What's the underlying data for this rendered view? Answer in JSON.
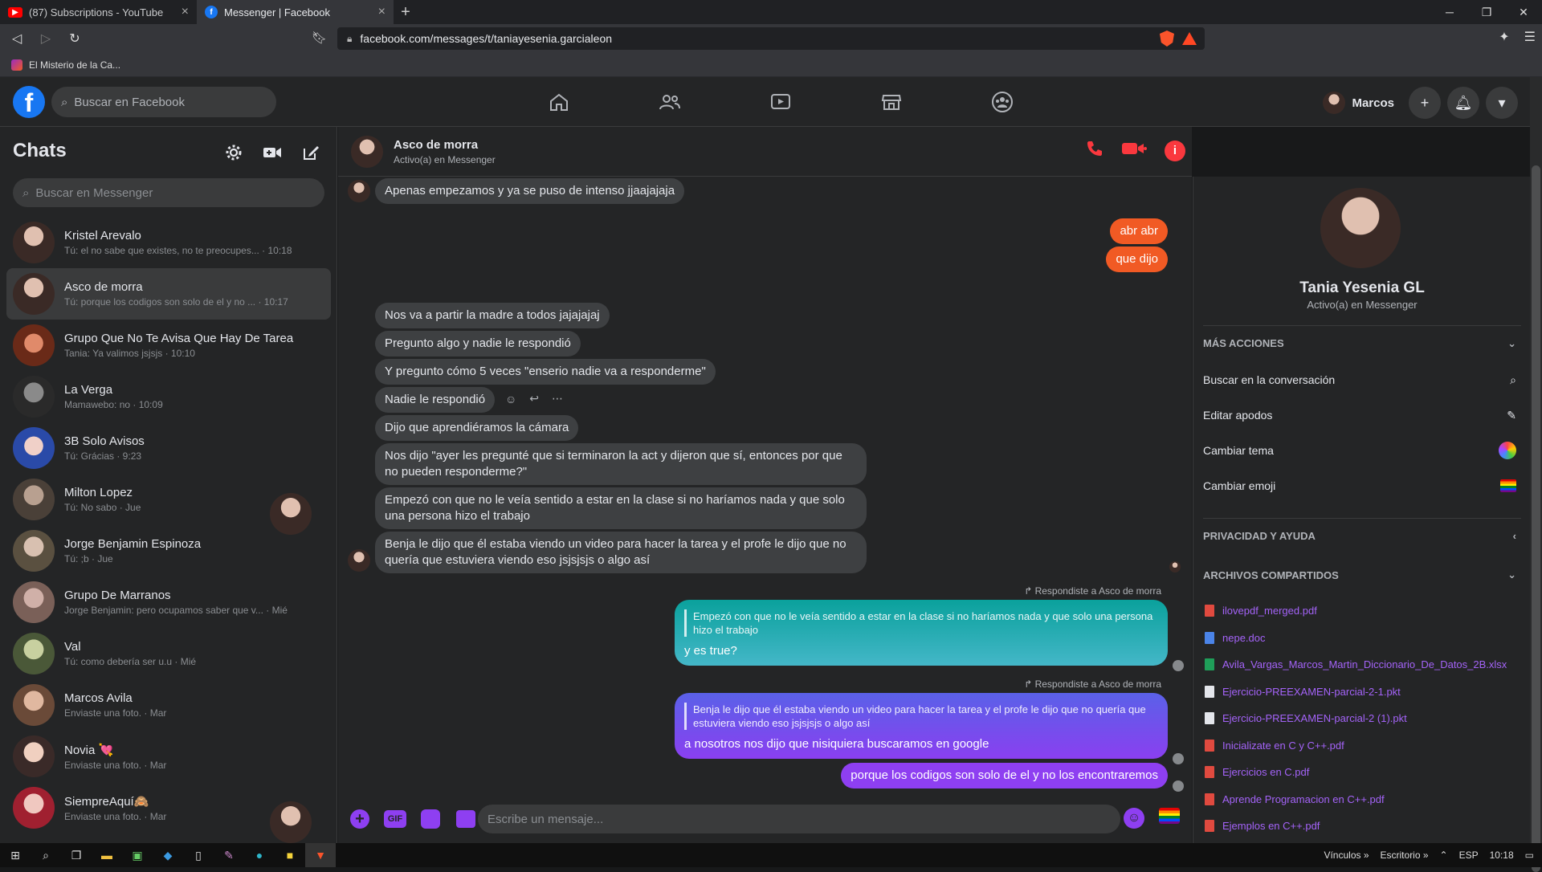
{
  "browser": {
    "tabs": [
      {
        "title": "(87) Subscriptions - YouTube",
        "icon": "youtube-icon",
        "active": false
      },
      {
        "title": "Messenger | Facebook",
        "icon": "facebook-icon",
        "active": true
      }
    ],
    "url": "facebook.com/messages/t/taniayesenia.garcialeon",
    "bookmark": "El Misterio de la Ca..."
  },
  "fb": {
    "search_placeholder": "Buscar en Facebook",
    "user_name": "Marcos"
  },
  "sidebar": {
    "title": "Chats",
    "search_placeholder": "Buscar en Messenger",
    "chats": [
      {
        "name": "Kristel Arevalo",
        "preview": "Tú: el no sabe que existes, no te preocupes... · 10:18"
      },
      {
        "name": "Asco de morra",
        "preview": "Tú: porque los codigos son solo de el y no ... · 10:17"
      },
      {
        "name": "Grupo Que No Te Avisa Que Hay De Tarea",
        "preview": "Tania: Ya valimos jsjsjs · 10:10"
      },
      {
        "name": "La Verga",
        "preview": "Mamawebo: no · 10:09"
      },
      {
        "name": "3B Solo Avisos",
        "preview": "Tú: Grácias · 9:23"
      },
      {
        "name": "Milton Lopez",
        "preview": "Tú: No sabo · Jue"
      },
      {
        "name": "Jorge Benjamin Espinoza",
        "preview": "Tú: ;b · Jue"
      },
      {
        "name": "Grupo De Marranos",
        "preview": "Jorge Benjamin: pero ocupamos saber que v... · Mié"
      },
      {
        "name": "Val",
        "preview": "Tú: como debería ser u.u · Mié"
      },
      {
        "name": "Marcos Avila",
        "preview": "Enviaste una foto. · Mar"
      },
      {
        "name": "Novia 💘",
        "preview": "Enviaste una foto. · Mar"
      },
      {
        "name": "SiempreAquí🙈",
        "preview": "Enviaste una foto. · Mar"
      }
    ]
  },
  "conversation": {
    "name": "Asco de morra",
    "status": "Activo(a) en Messenger",
    "messages": {
      "m1": "Apenas empezamos y ya se puso de intenso jjaajajaja",
      "o1": "abr abr",
      "o2": "que dijo",
      "m2": "Nos va a partir la madre a todos jajajajaj",
      "m3": "Pregunto algo y nadie le respondió",
      "m4": "Y pregunto cómo 5 veces \"enserio nadie va a responderme\"",
      "m5": "Nadie le respondió",
      "m6": "Dijo que aprendiéramos la cámara",
      "m7": "Nos dijo \"ayer les pregunté que si terminaron la act y dijeron que sí, entonces por que no pueden responderme?\"",
      "m8": "Empezó con que no le veía sentido a estar en la clase si no haríamos nada y que solo una persona hizo el trabajo",
      "m9": "Benja le dijo que él estaba viendo un video para hacer la tarea y el profe le dijo que no quería que estuviera viendo eso jsjsjsjs o algo así",
      "reply_label": "Respondiste a Asco de morra",
      "r1_quote": "Empezó con que no le veía sentido a estar en la clase si no haríamos nada y que solo una persona hizo el trabajo",
      "r1_text": "y es true?",
      "r2_quote": "Benja le dijo que él estaba viendo un video para hacer la tarea y el profe le dijo que no quería que estuviera viendo eso jsjsjsjs o algo así",
      "r2_text": "a nosotros nos dijo que nisiquiera buscaramos en google",
      "o3": "porque los codigos son solo de el y no los encontraremos"
    },
    "composer_placeholder": "Escribe un mensaje..."
  },
  "info": {
    "name": "Tania Yesenia GL",
    "status": "Activo(a) en Messenger",
    "more_actions": "MÁS ACCIONES",
    "actions": [
      "Buscar en la conversación",
      "Editar apodos",
      "Cambiar tema",
      "Cambiar emoji"
    ],
    "privacy": "PRIVACIDAD Y AYUDA",
    "shared_files": "ARCHIVOS COMPARTIDOS",
    "files": [
      {
        "name": "ilovepdf_merged.pdf",
        "type": "pdf"
      },
      {
        "name": "nepe.doc",
        "type": "doc"
      },
      {
        "name": "Avila_Vargas_Marcos_Martin_Diccionario_De_Datos_2B.xlsx",
        "type": "xls"
      },
      {
        "name": "Ejercicio-PREEXAMEN-parcial-2-1.pkt",
        "type": "gen"
      },
      {
        "name": "Ejercicio-PREEXAMEN-parcial-2 (1).pkt",
        "type": "gen"
      },
      {
        "name": "Inicializate en C y C++.pdf",
        "type": "pdf"
      },
      {
        "name": "Ejercicios en C.pdf",
        "type": "pdf"
      },
      {
        "name": "Aprende Programacion en C++.pdf",
        "type": "pdf"
      },
      {
        "name": "Ejemplos en C++.pdf",
        "type": "pdf"
      }
    ]
  },
  "taskbar": {
    "links": "Vínculos",
    "desktop": "Escritorio",
    "lang": "ESP",
    "time": "10:18"
  }
}
